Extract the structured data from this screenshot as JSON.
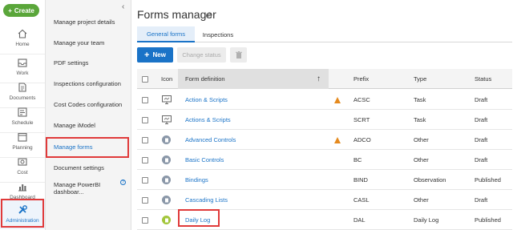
{
  "rail": {
    "create_label": "Create",
    "items": [
      {
        "label": "Home",
        "icon": "home-icon"
      },
      {
        "label": "Work",
        "icon": "work-icon"
      },
      {
        "label": "Documents",
        "icon": "documents-icon"
      },
      {
        "label": "Schedule",
        "icon": "schedule-icon"
      },
      {
        "label": "Planning",
        "icon": "planning-icon"
      },
      {
        "label": "Cost",
        "icon": "cost-icon"
      },
      {
        "label": "Dashboard",
        "icon": "dashboard-icon"
      },
      {
        "label": "Administration",
        "icon": "administration-icon"
      }
    ]
  },
  "submenu": {
    "items": [
      "Manage project details",
      "Manage your team",
      "PDF settings",
      "Inspections configuration",
      "Cost Codes configuration",
      "Manage iModel",
      "Manage forms",
      "Document settings",
      "Manage PowerBI dashboar..."
    ],
    "active_index": 6
  },
  "main": {
    "title": "Forms manager",
    "tabs": [
      {
        "label": "General forms",
        "active": true
      },
      {
        "label": "Inspections",
        "active": false
      }
    ],
    "toolbar": {
      "new_label": "New",
      "change_status_label": "Change status"
    },
    "table": {
      "headers": {
        "icon": "Icon",
        "form_definition": "Form definition",
        "prefix": "Prefix",
        "type": "Type",
        "status": "Status"
      },
      "rows": [
        {
          "icon": "monitor",
          "name": "Action & Scripts",
          "warning": true,
          "prefix": "ACSC",
          "type": "Task",
          "status": "Draft"
        },
        {
          "icon": "monitor",
          "name": "Actions & Scripts",
          "warning": false,
          "prefix": "SCRT",
          "type": "Task",
          "status": "Draft"
        },
        {
          "icon": "gray-circle",
          "name": "Advanced Controls",
          "warning": true,
          "prefix": "ADCO",
          "type": "Other",
          "status": "Draft"
        },
        {
          "icon": "gray-circle",
          "name": "Basic Controls",
          "warning": false,
          "prefix": "BC",
          "type": "Other",
          "status": "Draft"
        },
        {
          "icon": "gray-circle",
          "name": "Bindings",
          "warning": false,
          "prefix": "BIND",
          "type": "Observation",
          "status": "Published"
        },
        {
          "icon": "gray-circle",
          "name": "Cascading Lists",
          "warning": false,
          "prefix": "CASL",
          "type": "Other",
          "status": "Draft"
        },
        {
          "icon": "green-circle",
          "name": "Daily Log",
          "warning": false,
          "prefix": "DAL",
          "type": "Daily Log",
          "status": "Published"
        }
      ]
    }
  },
  "colors": {
    "accent": "#1a73c7",
    "create": "#5aa63a",
    "highlight": "#e03a3a",
    "warning": "#e58a1f"
  }
}
